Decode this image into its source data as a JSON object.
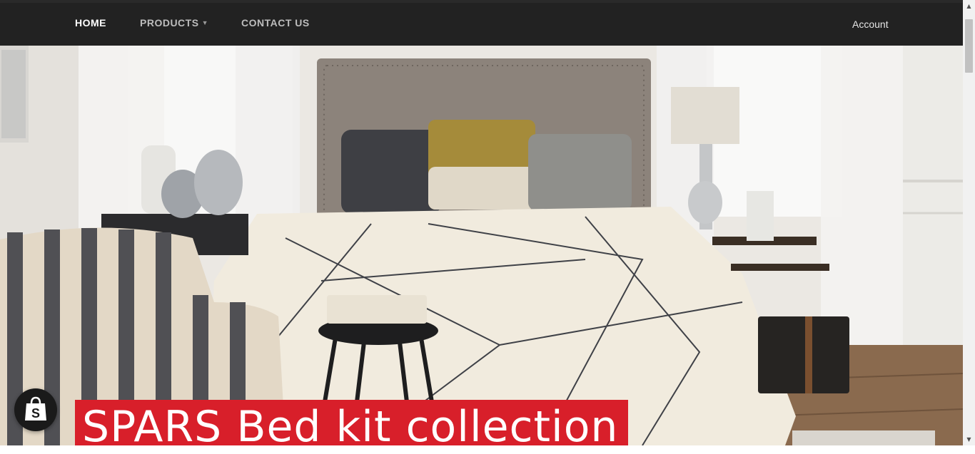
{
  "nav": {
    "home": "HOME",
    "products": "PRODUCTS",
    "contact": "CONTACT US",
    "account": "Account"
  },
  "hero": {
    "banner_text": "SPARS Bed kit collection"
  },
  "icons": {
    "products_dropdown": "chevron-down-icon",
    "store_badge": "shopping-bag-icon"
  },
  "colors": {
    "nav_bg": "#222222",
    "accent": "#d81f2a"
  }
}
